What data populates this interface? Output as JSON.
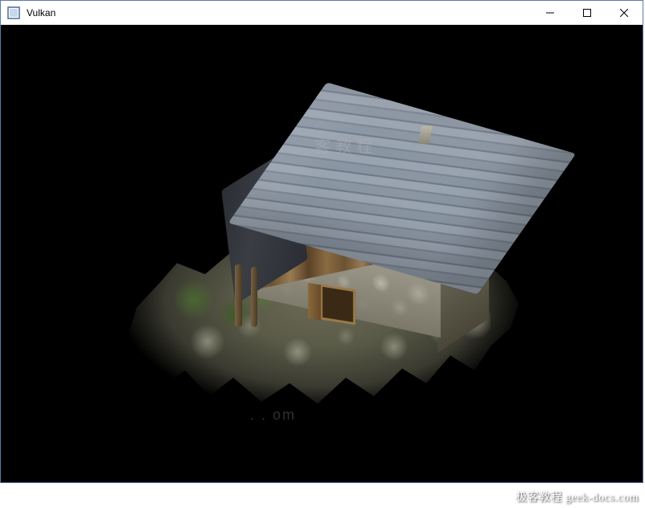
{
  "window": {
    "title": "Vulkan",
    "icon_name": "app-icon",
    "controls": {
      "minimize": "minimize",
      "maximize": "maximize",
      "close": "close"
    }
  },
  "viewport": {
    "background_color": "#000000",
    "scene_description": "3D textured mesh of a stone-and-wood cabin with corrugated metal roof on rocky terrain",
    "watermark_center": "客教程",
    "watermark_low": ". . om"
  },
  "footer": {
    "credit_text": "极客教程 geek-docs.com"
  },
  "colors": {
    "titlebar_bg": "#ffffff",
    "border": "#5a7ca8",
    "viewport_bg": "#000000",
    "roof": "#8b96a3",
    "wood": "#8a6b42",
    "stone": "#9a9688"
  }
}
